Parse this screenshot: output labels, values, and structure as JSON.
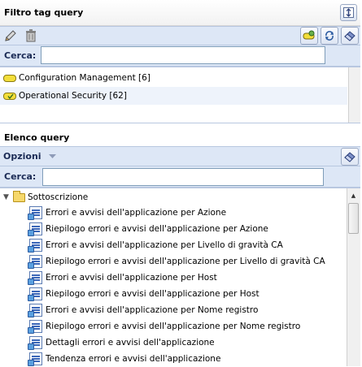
{
  "filter_panel": {
    "title": "Filtro tag query",
    "collapse_icon": "collapse-icon",
    "toolbar_left_icons": [
      "pencil-icon",
      "trash-icon"
    ],
    "toolbar_right_icons": [
      "tag-add-icon",
      "refresh-icon",
      "eraser-icon"
    ],
    "search_label": "Cerca:",
    "search_value": "",
    "tags": [
      {
        "label": "Configuration Management [6]",
        "icon": "tag-icon"
      },
      {
        "label": "Operational Security [62]",
        "icon": "tag-checked-icon"
      }
    ]
  },
  "query_panel": {
    "title": "Elenco query",
    "options_label": "Opzioni",
    "options_icon": "dropdown-arrow-icon",
    "eraser_icon": "eraser-icon",
    "search_label": "Cerca:",
    "search_value": "",
    "folder": {
      "label": "Sottoscrizione",
      "expanded": true
    },
    "items": [
      "Errori e avvisi dell'applicazione per Azione",
      "Riepilogo errori e avvisi dell'applicazione per Azione",
      "Errori e avvisi dell'applicazione per Livello di gravità CA",
      "Riepilogo errori e avvisi dell'applicazione per Livello di gravità CA",
      "Errori e avvisi dell'applicazione per Host",
      "Riepilogo errori e avvisi dell'applicazione per Host",
      "Errori e avvisi dell'applicazione per Nome registro",
      "Riepilogo errori e avvisi dell'applicazione per Nome registro",
      "Dettagli errori e avvisi dell'applicazione",
      "Tendenza errori e avvisi dell'applicazione"
    ]
  }
}
